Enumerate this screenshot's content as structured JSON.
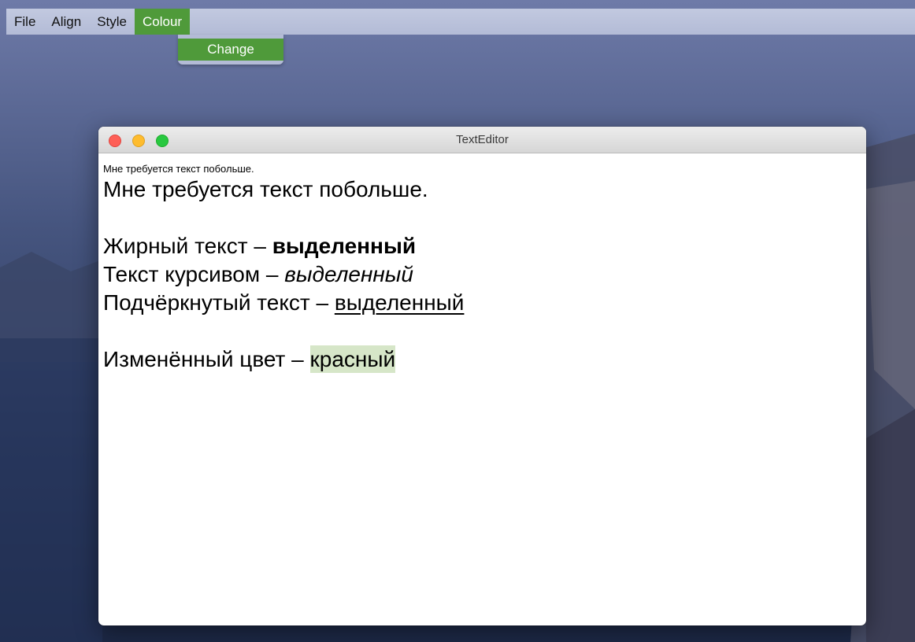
{
  "menubar": {
    "items": [
      "File",
      "Align",
      "Style",
      "Colour"
    ],
    "active": "Colour"
  },
  "dropdown": {
    "items": [
      "Change"
    ]
  },
  "window": {
    "title": "TextEditor"
  },
  "editor": {
    "line1": "Мне требуется текст побольше.",
    "line2": "Мне требуется текст побольше.",
    "bold_prefix": "Жирный текст – ",
    "bold_word": "выделенный",
    "italic_prefix": "Текст курсивом – ",
    "italic_word": "выделенный",
    "underline_prefix": "Подчёркнутый текст – ",
    "underline_word": "выделенный",
    "colour_prefix": "Изменённый цвет – ",
    "colour_word": "красный"
  },
  "colors": {
    "menu_highlight": "#4f9a3a",
    "text_highlight": "#d6e6c8",
    "traffic_close": "#fe5f57",
    "traffic_minimize": "#febc2e",
    "traffic_zoom": "#28c840"
  }
}
